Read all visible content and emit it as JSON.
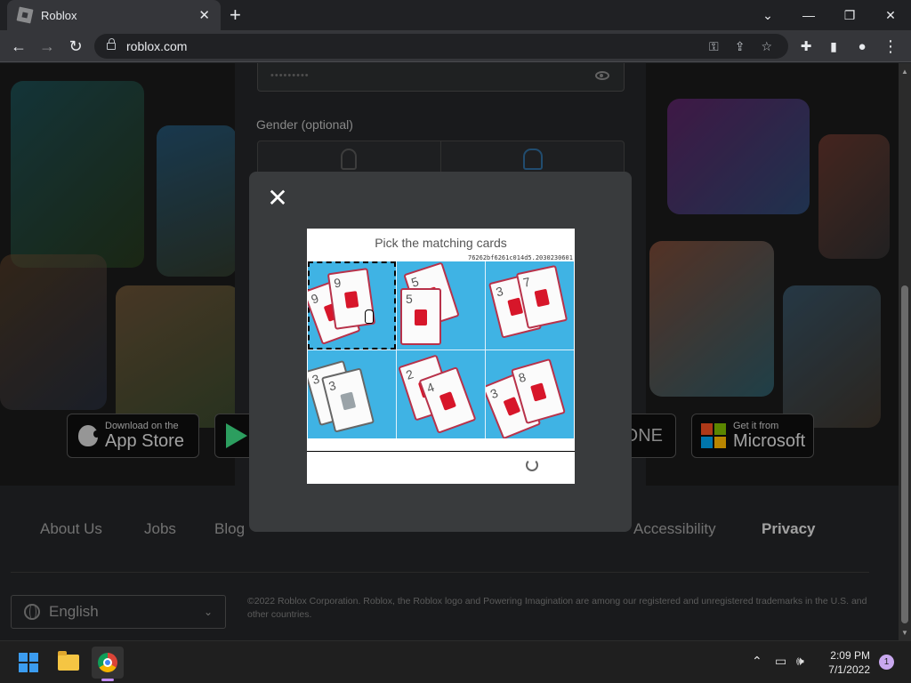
{
  "browser": {
    "tab_title": "Roblox",
    "url": "roblox.com"
  },
  "form": {
    "password_mask": "•••••••••",
    "gender_label": "Gender (optional)"
  },
  "captcha": {
    "title": "Pick the matching cards",
    "hash": "76262bf6261c014d5.2030230601",
    "cells": [
      {
        "cards": [
          "9",
          "9"
        ],
        "selected": true
      },
      {
        "cards": [
          "5",
          "5"
        ],
        "selected": false
      },
      {
        "cards": [
          "3",
          "7"
        ],
        "selected": false
      },
      {
        "cards": [
          "3",
          "3"
        ],
        "selected": false
      },
      {
        "cards": [
          "2",
          "4"
        ],
        "selected": false
      },
      {
        "cards": [
          "3",
          "8"
        ],
        "selected": false
      }
    ]
  },
  "stores": {
    "apple_small": "Download on the",
    "apple_big": "App Store",
    "xbox_partial": "ONE",
    "ms_small": "Get it from",
    "ms_big": "Microsoft"
  },
  "footer": {
    "links": [
      "About Us",
      "Jobs",
      "Blog",
      "Accessibility",
      "Privacy"
    ],
    "language": "English",
    "copyright": "©2022 Roblox Corporation. Roblox, the Roblox logo and Powering Imagination are among our registered and unregistered trademarks in the U.S. and other countries."
  },
  "taskbar": {
    "time": "2:09 PM",
    "date": "7/1/2022",
    "notifications": "1"
  },
  "colors": {
    "accent": "#3fb3e4",
    "card_suit": "#d7162a"
  }
}
